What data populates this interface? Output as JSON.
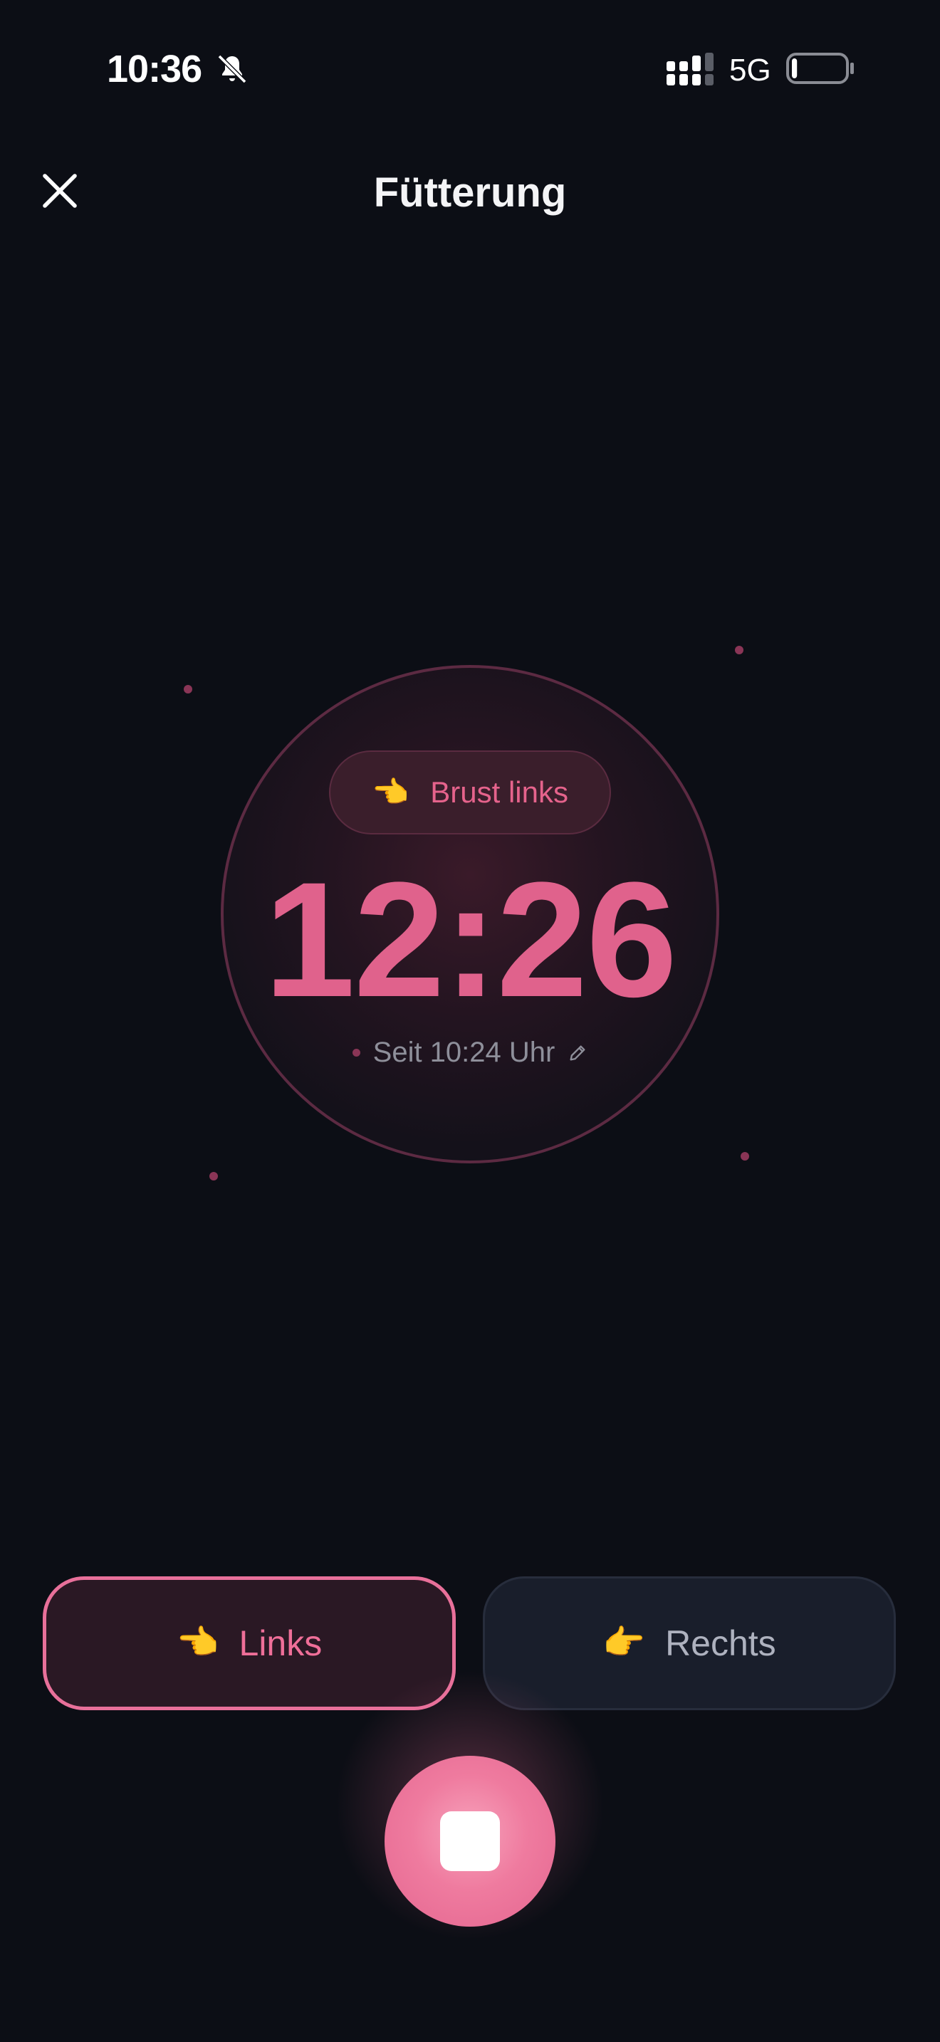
{
  "status_bar": {
    "time": "10:36",
    "network": "5G",
    "bell_icon": "bell-muted-icon",
    "signal_icon": "signal-bars-icon",
    "battery_icon": "battery-low-icon",
    "battery_level": 0.1
  },
  "header": {
    "title": "Fütterung",
    "close_icon": "close-icon"
  },
  "timer": {
    "side_pill_icon": "👈",
    "side_pill_label": "Brust links",
    "elapsed": "12:26",
    "since_label": "Seit 10:24 Uhr",
    "edit_icon": "pencil-icon"
  },
  "side_buttons": {
    "left": {
      "icon": "👈",
      "label": "Links",
      "selected": true
    },
    "right": {
      "icon": "👉",
      "label": "Rechts",
      "selected": false
    }
  },
  "stop_button": {
    "icon": "stop-icon"
  },
  "colors": {
    "background": "#0c0e15",
    "accent": "#e0628c",
    "accent_light": "#ef7b9f",
    "muted_text": "#8e8f9a",
    "inactive_button": "#191e2b"
  }
}
